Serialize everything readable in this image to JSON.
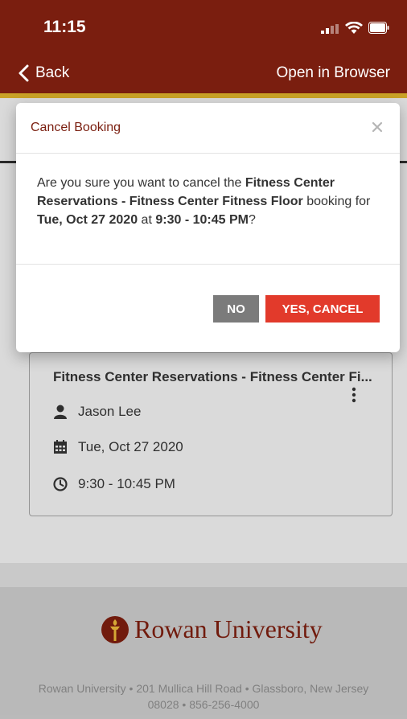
{
  "status_bar": {
    "time": "11:15"
  },
  "nav": {
    "back_label": "Back",
    "open_browser_label": "Open in Browser"
  },
  "modal": {
    "title": "Cancel Booking",
    "body": {
      "p1": "Are you sure you want to cancel the ",
      "resource": "Fitness Center Reservations - Fitness Center Fitness Floor",
      "p2": " booking for ",
      "date": "Tue, Oct 27 2020",
      "p3": " at ",
      "time": "9:30 - 10:45 PM",
      "p4": "?"
    },
    "no_label": "NO",
    "yes_label": "YES, CANCEL"
  },
  "booking": {
    "title": "Fitness Center Reservations - Fitness Center Fi...",
    "user": "Jason Lee",
    "date": "Tue, Oct 27 2020",
    "time": "9:30 - 10:45 PM"
  },
  "footer": {
    "logo_text": "Rowan University",
    "address_line1": "Rowan University • 201 Mullica Hill Road • Glassboro, New Jersey",
    "address_line2": "08028 • 856-256-4000"
  },
  "colors": {
    "brand": "#7a1e0f",
    "accent_gold": "#c9a227",
    "confirm_red": "#e23a2b",
    "neutral_gray": "#7b7b7b"
  }
}
